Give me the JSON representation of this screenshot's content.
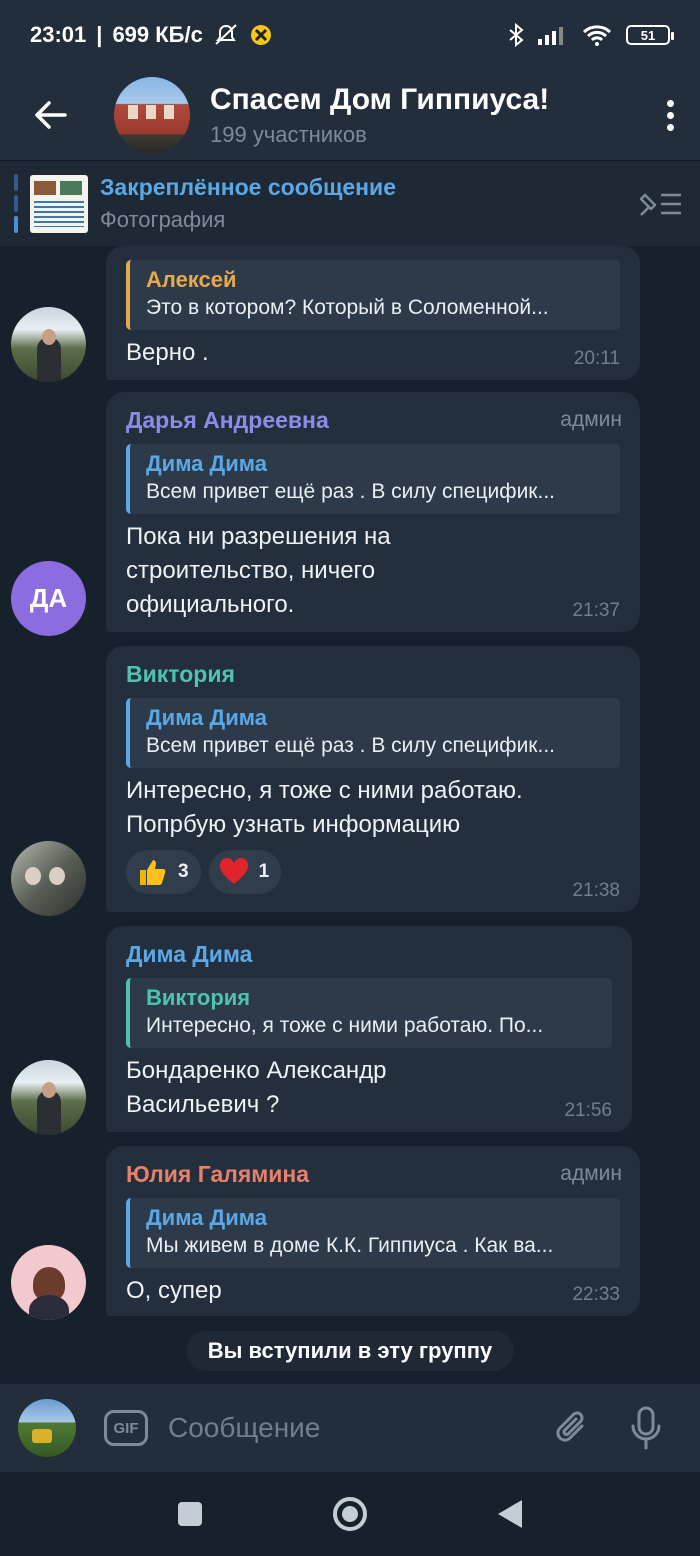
{
  "status_bar": {
    "time": "23:01",
    "speed": "699 КБ/с",
    "battery": "51"
  },
  "header": {
    "title": "Спасем Дом Гиппиуса!",
    "subtitle": "199 участников"
  },
  "pinned": {
    "title": "Закреплённое сообщение",
    "subtitle": "Фотография"
  },
  "messages": [
    {
      "author": "",
      "reply_author": "Алексей",
      "reply_text": "Это в котором? Который в Соломенной...",
      "text": "Верно .",
      "time": "20:11"
    },
    {
      "author": "Дарья Андреевна",
      "badge": "админ",
      "avatar_initials": "ДА",
      "reply_author": "Дима Дима",
      "reply_text": "Всем привет ещё раз . В силу специфик...",
      "text": "Пока ни разрешения на строительство, ничего официального.",
      "time": "21:37"
    },
    {
      "author": "Виктория",
      "reply_author": "Дима Дима",
      "reply_text": "Всем привет ещё раз . В силу специфик...",
      "text": "Интересно, я тоже с ними работаю. Попрбую узнать информацию",
      "time": "21:38",
      "reactions": [
        {
          "emoji": "thumbs-up",
          "count": "3"
        },
        {
          "emoji": "heart",
          "count": "1"
        }
      ]
    },
    {
      "author": "Дима Дима",
      "reply_author": "Виктория",
      "reply_text": "Интересно, я тоже с ними работаю. По...",
      "text": "Бондаренко Александр Васильевич ?",
      "time": "21:56"
    },
    {
      "author": "Юлия Галямина",
      "badge": "админ",
      "reply_author": "Дима Дима",
      "reply_text": "Мы живем в доме К.К. Гиппиуса . Как ва...",
      "text": "О, супер",
      "time": "22:33"
    }
  ],
  "system_message": "Вы вступили в эту группу",
  "composer": {
    "gif_label": "GIF",
    "placeholder": "Сообщение"
  },
  "colors": {
    "background": "#17212b",
    "bubble": "#242f3d",
    "accent": "#5aa9e6",
    "author_darya": "#8c8ce8",
    "author_viktoria": "#4fc3b0",
    "author_dima": "#5aa9e6",
    "author_julia": "#e8806a",
    "reply_alexey": "#e8a84c"
  }
}
